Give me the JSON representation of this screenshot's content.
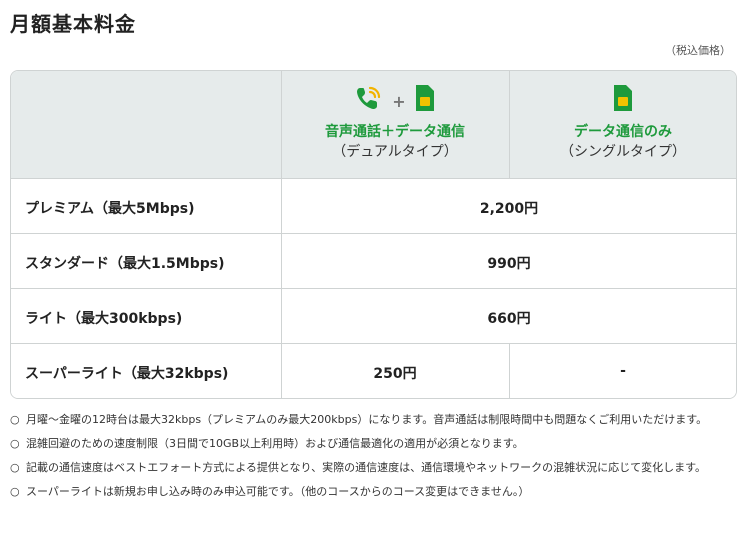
{
  "page": {
    "title": "月額基本料金",
    "tax_note": "（税込価格）"
  },
  "columns": [
    {
      "name": "音声通話＋データ通信",
      "sub": "（デュアルタイプ）",
      "icons": [
        "phone-icon",
        "sim-card-icon"
      ]
    },
    {
      "name": "データ通信のみ",
      "sub": "（シングルタイプ）",
      "icons": [
        "sim-card-icon"
      ]
    }
  ],
  "header_plus": "+",
  "rows": [
    {
      "label": "プレミアム（最大5Mbps)",
      "value": "2,200円"
    },
    {
      "label": "スタンダード（最大1.5Mbps)",
      "value": "990円"
    },
    {
      "label": "ライト（最大300kbps)",
      "value": "660円"
    },
    {
      "label": "スーパーライト（最大32kbps)",
      "dual": "250円",
      "single": "-"
    }
  ],
  "notes_bullet": "○",
  "notes": [
    "月曜～金曜の12時台は最大32kbps（プレミアムのみ最大200kbps）になります。音声通話は制限時間中も問題なくご利用いただけます。",
    "混雑回避のための速度制限（3日間で10GB以上利用時）および通信最適化の適用が必須となります。",
    "記載の通信速度はベストエフォート方式による提供となり、実際の通信速度は、通信環境やネットワークの混雑状況に応じて変化します。",
    "スーパーライトは新規お申し込み時のみ申込可能です。（他のコースからのコース変更はできません。）"
  ],
  "colors": {
    "accent_green": "#1e9a3c",
    "header_bg": "#e6ebeb",
    "border": "#cfd3d3"
  }
}
